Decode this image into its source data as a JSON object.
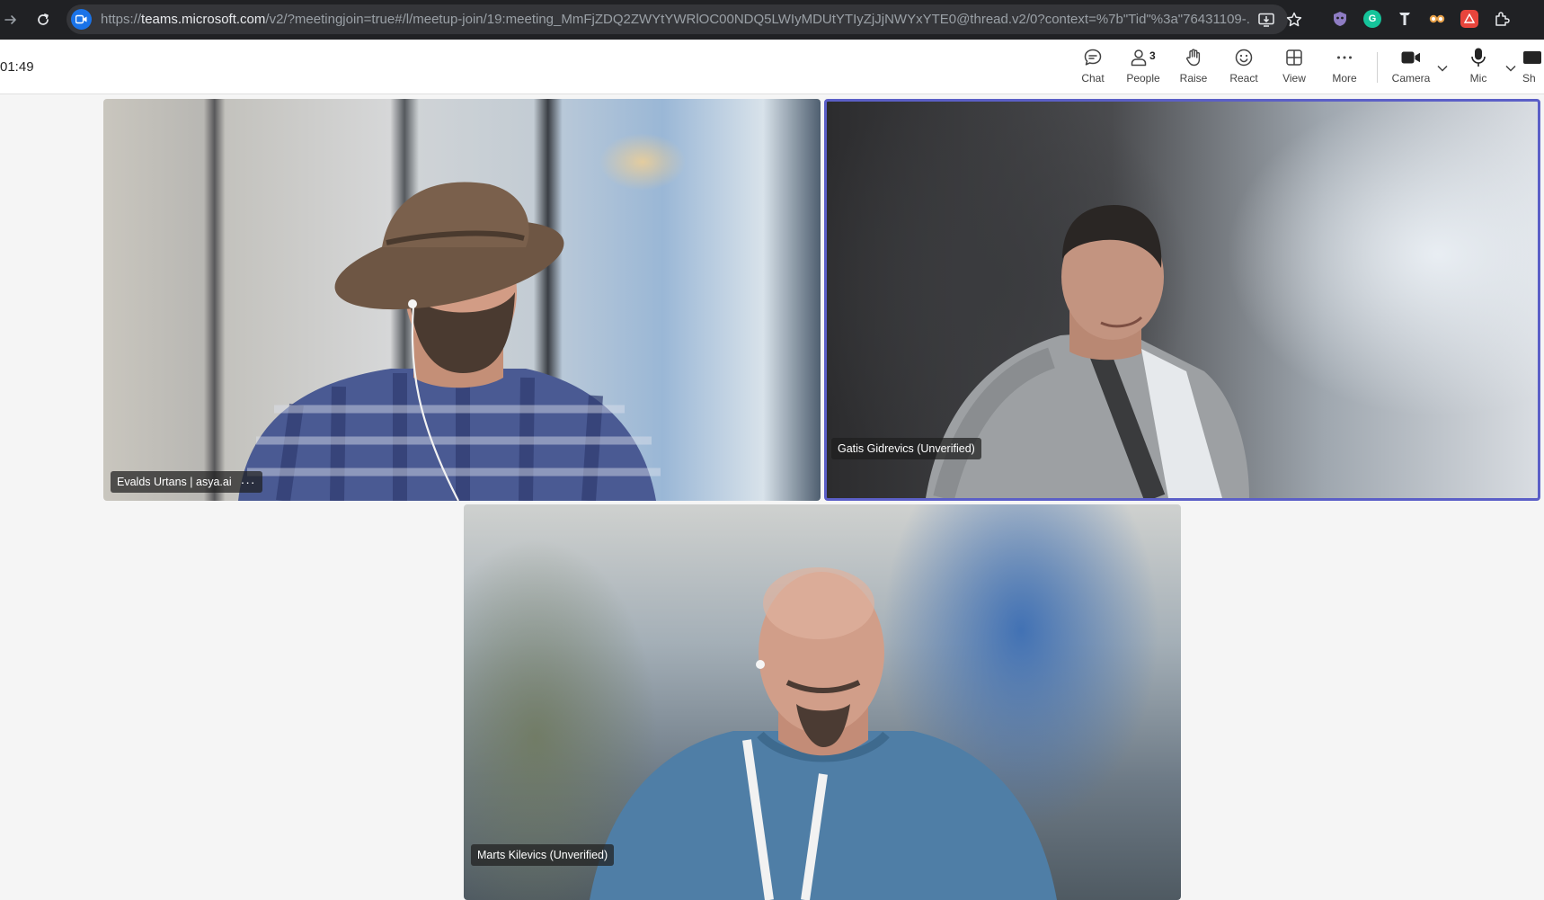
{
  "browser": {
    "url_scheme": "https://",
    "url_host": "teams.microsoft.com",
    "url_rest": "/v2/?meetingjoin=true#/l/meetup-join/19:meeting_MmFjZDQ2ZWYtYWRlOC00NDQ5LWIyMDUtYTIyZjJjNWYxYTE0@thread.v2/0?context=%7b\"Tid\"%3a\"76431109-...",
    "icons": {
      "forward": "arrow-right-icon",
      "reload": "reload-icon",
      "site": "teams-video-icon",
      "install": "install-app-icon",
      "bookmark": "star-icon"
    },
    "extensions": [
      {
        "name": "extension-shield-icon",
        "color": "#8e7cc3"
      },
      {
        "name": "extension-grammar-icon",
        "color": "#15c39a"
      },
      {
        "name": "extension-t-icon",
        "color": "#9aa0a6"
      },
      {
        "name": "extension-eyes-icon",
        "color": "#e8a24a"
      },
      {
        "name": "extension-red-icon",
        "color": "#e8453c"
      },
      {
        "name": "extensions-puzzle-icon",
        "color": "#e8eaed"
      }
    ]
  },
  "meeting": {
    "timer": "01:49",
    "toolbar": {
      "chat": "Chat",
      "people": "People",
      "people_count": "3",
      "raise": "Raise",
      "react": "React",
      "view": "View",
      "more": "More",
      "camera": "Camera",
      "mic": "Mic",
      "share": "Sh"
    },
    "participants": [
      {
        "name": "Evalds Urtans | asya.ai",
        "more": "···",
        "active_speaker": false
      },
      {
        "name": "Gatis Gidrevics (Unverified)",
        "active_speaker": true
      },
      {
        "name": "Marts Kilevics (Unverified)",
        "active_speaker": false
      }
    ]
  },
  "theme": {
    "accent": "#5b5fc7",
    "browser_bg": "#202124",
    "stage_bg": "#f5f5f5"
  }
}
